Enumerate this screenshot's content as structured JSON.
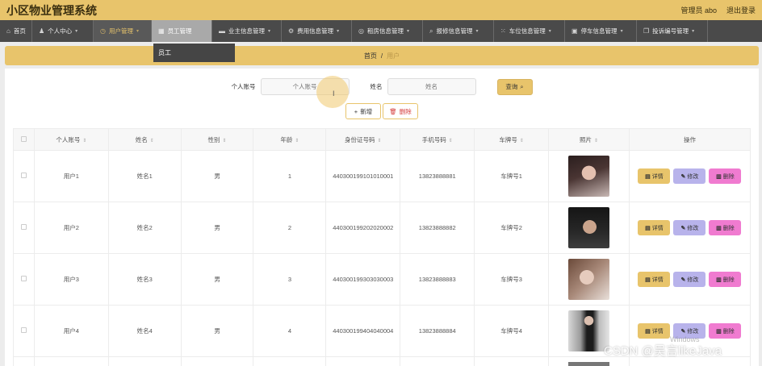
{
  "header": {
    "title": "小区物业管理系统",
    "admin": "管理员 abo",
    "logout": "退出登录"
  },
  "nav": [
    {
      "label": "首页",
      "icon": "home-icon",
      "glyph": "⌂"
    },
    {
      "label": "个人中心",
      "icon": "user-icon",
      "glyph": "♟"
    },
    {
      "label": "用户管理",
      "icon": "clock-icon",
      "glyph": "◷"
    },
    {
      "label": "员工管理",
      "icon": "grid-icon",
      "glyph": "▦"
    },
    {
      "label": "业主信息管理",
      "icon": "card-icon",
      "glyph": "▬"
    },
    {
      "label": "费用信息管理",
      "icon": "gear-icon",
      "glyph": "⚙"
    },
    {
      "label": "租房信息管理",
      "icon": "compass-icon",
      "glyph": "◎"
    },
    {
      "label": "报修信息管理",
      "icon": "search-icon",
      "glyph": "⌕"
    },
    {
      "label": "车位信息管理",
      "icon": "apps-icon",
      "glyph": "⁙"
    },
    {
      "label": "停车信息管理",
      "icon": "car-icon",
      "glyph": "▣"
    },
    {
      "label": "投诉编号管理",
      "icon": "copy-icon",
      "glyph": "❐"
    }
  ],
  "dropdown": {
    "item": "员工"
  },
  "breadcrumb": {
    "home": "首页",
    "sep": "/",
    "current": "用户"
  },
  "search": {
    "account_label": "个人账号",
    "account_placeholder": "个人账号",
    "name_label": "姓名",
    "name_placeholder": "姓名",
    "button": "查询"
  },
  "actions": {
    "add": "新增",
    "delete": "删除"
  },
  "table": {
    "headers": [
      "个人账号",
      "姓名",
      "性别",
      "年龄",
      "身份证号码",
      "手机号码",
      "车牌号",
      "照片",
      "操作"
    ],
    "rows": [
      {
        "account": "用户1",
        "name": "姓名1",
        "gender": "男",
        "age": "1",
        "id": "440300199101010001",
        "phone": "13823888881",
        "plate": "车牌号1"
      },
      {
        "account": "用户2",
        "name": "姓名2",
        "gender": "男",
        "age": "2",
        "id": "440300199202020002",
        "phone": "13823888882",
        "plate": "车牌号2"
      },
      {
        "account": "用户3",
        "name": "姓名3",
        "gender": "男",
        "age": "3",
        "id": "440300199303030003",
        "phone": "13823888883",
        "plate": "车牌号3"
      },
      {
        "account": "用户4",
        "name": "姓名4",
        "gender": "男",
        "age": "4",
        "id": "440300199404040004",
        "phone": "13823888884",
        "plate": "车牌号4"
      }
    ],
    "ops": {
      "detail": "详情",
      "edit": "修改",
      "delete": "删除"
    }
  },
  "watermark": "CSDN @吴言likeJava",
  "os_watermark": "Windows",
  "colors": {
    "accent": "#e8c46b",
    "nav_bg": "#4a4a4a",
    "edit": "#b8b3eb",
    "delete": "#f07bd0"
  }
}
